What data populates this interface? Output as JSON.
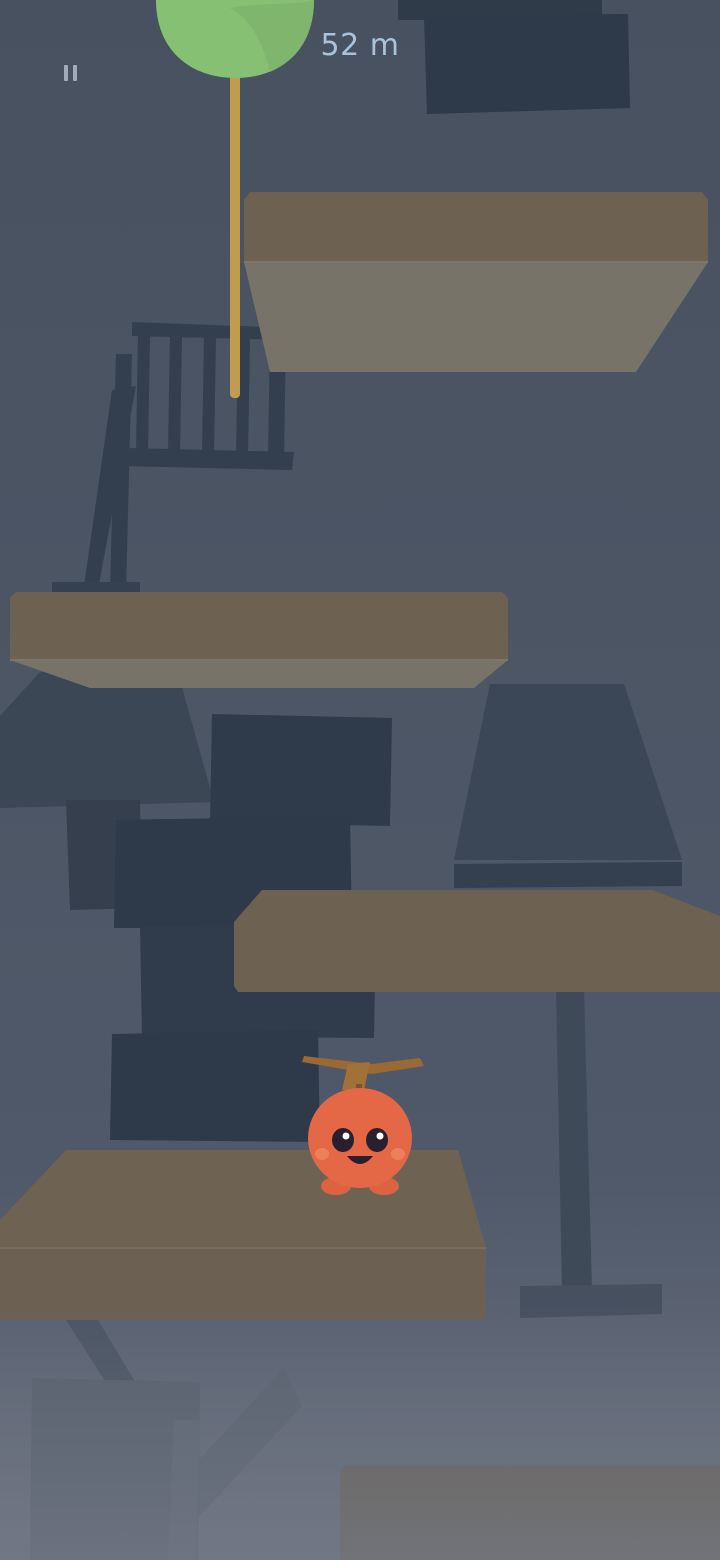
{
  "hud": {
    "height_readout": "52 m",
    "pause_icon": "pause-icon"
  },
  "colors": {
    "background_top": "#47515f",
    "background_bottom": "#6c7280",
    "platform_top": "#6d6252",
    "platform_side": "#787368",
    "furniture_dark": "#303b4a",
    "furniture_mid": "#3a4555",
    "pole": "#c29c4c",
    "balloon": "#86c073",
    "character_body": "#e46845",
    "propeller": "#9a6a35"
  }
}
